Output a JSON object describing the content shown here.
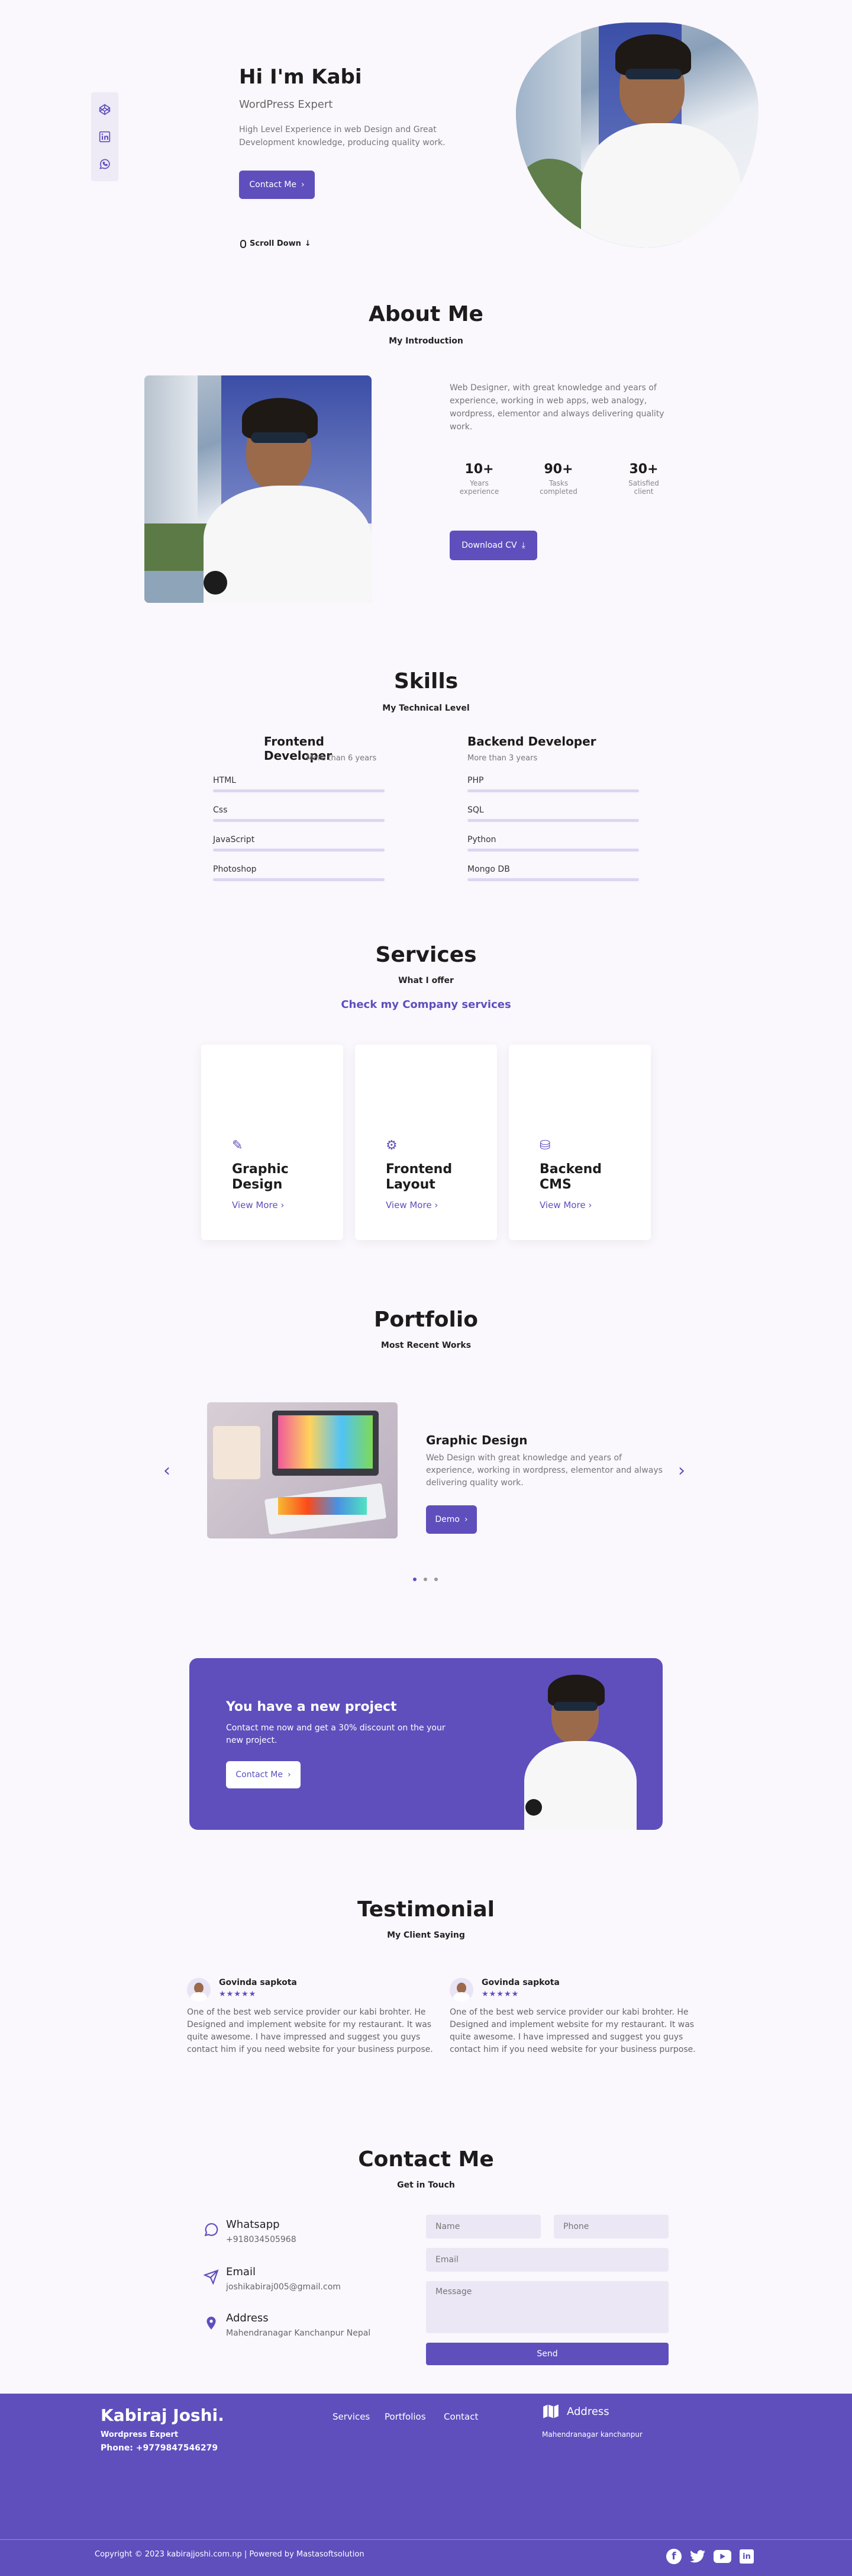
{
  "hero": {
    "greeting": "Hi I'm Kabi",
    "role": "WordPress Expert",
    "description": "High Level Experience in web Design and Great Development knowledge, producing quality work.",
    "contact_label": "Contact Me",
    "scroll_label": "Scroll Down",
    "social_icons": [
      "codepen-icon",
      "linkedin-icon",
      "whatsapp-icon"
    ]
  },
  "about": {
    "title": "About Me",
    "subtitle": "My Introduction",
    "description": "Web Designer, with great knowledge and years of experience, working in web apps, web analogy, wordpress, elementor and always delivering quality work.",
    "stats": [
      {
        "value": "10+",
        "label1": "Years",
        "label2": "experience"
      },
      {
        "value": "90+",
        "label1": "Tasks",
        "label2": "completed"
      },
      {
        "value": "30+",
        "label1": "Satisfied",
        "label2": "client"
      }
    ],
    "download_label": "Download CV"
  },
  "skills": {
    "title": "Skills",
    "subtitle": "My Technical Level",
    "frontend": {
      "title": "Frontend Developer",
      "years": "More than 6 years",
      "items": [
        "HTML",
        "Css",
        "JavaScript",
        "Photoshop"
      ]
    },
    "backend": {
      "title": "Backend Developer",
      "years": "More than 3 years",
      "items": [
        "PHP",
        "SQL",
        "Python",
        "Mongo DB"
      ]
    }
  },
  "services": {
    "title": "Services",
    "subtitle": "What I offer",
    "tagline": "Check my Company services",
    "cards": [
      {
        "line1": "Graphic",
        "line2": "Design",
        "link": "View More"
      },
      {
        "line1": "Frontend",
        "line2": "Layout",
        "link": "View More"
      },
      {
        "line1": "Backend",
        "line2": "CMS",
        "link": "View More"
      }
    ]
  },
  "portfolio": {
    "title": "Portfolio",
    "subtitle": "Most Recent Works",
    "item_title": "Graphic Design",
    "item_description": "Web Design with great knowledge and years of experience, working in wordpress, elementor and always delivering quality work.",
    "demo_label": "Demo"
  },
  "project": {
    "title": "You have a new project",
    "description": "Contact me now and get a 30% discount on the your new project.",
    "button": "Contact Me"
  },
  "testimonial": {
    "title": "Testimonial",
    "subtitle": "My Client Saying",
    "items": [
      {
        "name": "Govinda sapkota",
        "stars": "★★★★★",
        "text": "One of the best web service provider our kabi brohter. He Designed and implement website for my restaurant. It was quite awesome. I have impressed and suggest you guys contact him if you need website for your business purpose."
      },
      {
        "name": "Govinda sapkota",
        "stars": "★★★★★",
        "text": "One of the best web service provider our kabi brohter. He Designed and implement website for my restaurant. It was quite awesome. I have impressed and suggest you guys contact him if you need website for your business purpose."
      }
    ]
  },
  "contact": {
    "title": "Contact Me",
    "subtitle": "Get in Touch",
    "rows": [
      {
        "title": "Whatsapp",
        "value": "+918034505968"
      },
      {
        "title": "Email",
        "value": "joshikabiraj005@gmail.com"
      },
      {
        "title": "Address",
        "value": "Mahendranagar Kanchanpur Nepal"
      }
    ],
    "name_placeholder": "Name",
    "phone_placeholder": "Phone",
    "email_placeholder": "Email",
    "message_placeholder": "Message",
    "send_label": "Send"
  },
  "footer": {
    "brand": "Kabiraj Joshi.",
    "role": "Wordpress Expert",
    "phone": "Phone: +9779847546279",
    "links": [
      "Services",
      "Portfolios",
      "Contact"
    ],
    "address_title": "Address",
    "address_value": "Mahendranagar kanchanpur",
    "copyright": "Copyright © 2023 kabirajjoshi.com.np | Powered by Mastasoftsolution"
  },
  "colors": {
    "accent": "#5e4fbd",
    "background": "#faf7fd"
  }
}
